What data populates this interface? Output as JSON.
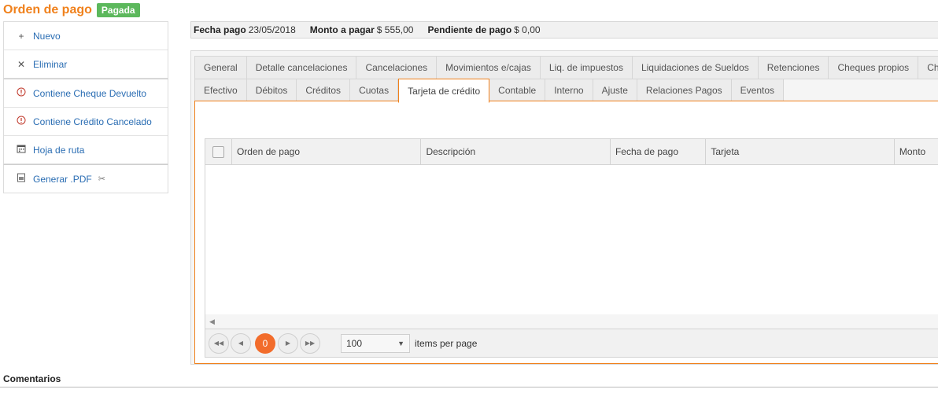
{
  "header": {
    "title": "Orden de pago",
    "status_badge": "Pagada"
  },
  "sidebar": {
    "groups": [
      [
        {
          "label": "Nuevo",
          "icon": "plus-icon"
        },
        {
          "label": "Eliminar",
          "icon": "close-icon"
        }
      ],
      [
        {
          "label": "Contiene Cheque Devuelto",
          "icon": "alert-circle-icon"
        },
        {
          "label": "Contiene Crédito Cancelado",
          "icon": "alert-circle-icon"
        },
        {
          "label": "Hoja de ruta",
          "icon": "calendar-icon"
        }
      ],
      [
        {
          "label": "Generar .PDF",
          "icon": "pdf-icon"
        }
      ]
    ]
  },
  "summary": {
    "fecha_label": "Fecha pago",
    "fecha_value": "23/05/2018",
    "monto_label": "Monto a pagar",
    "monto_value": "$ 555,00",
    "pendiente_label": "Pendiente de pago",
    "pendiente_value": "$ 0,00"
  },
  "tabs": {
    "row1": [
      "General",
      "Detalle cancelaciones",
      "Cancelaciones",
      "Movimientos e/cajas",
      "Liq. de impuestos",
      "Liquidaciones de Sueldos",
      "Retenciones",
      "Cheques propios",
      "Cheques"
    ],
    "row2": [
      "Efectivo",
      "Débitos",
      "Créditos",
      "Cuotas",
      "Tarjeta de crédito",
      "Contable",
      "Interno",
      "Ajuste",
      "Relaciones Pagos",
      "Eventos"
    ],
    "active": "Tarjeta de crédito"
  },
  "grid": {
    "columns": [
      "Orden de pago",
      "Descripción",
      "Fecha de pago",
      "Tarjeta",
      "Monto"
    ],
    "rows": []
  },
  "pager": {
    "current_page": "0",
    "page_size": "100",
    "items_label": "items per page"
  },
  "comments_label": "Comentarios",
  "colors": {
    "accent": "#f0811c",
    "badge": "#5cb85c",
    "link": "#2a6db3",
    "page_active": "#f26c2b"
  }
}
